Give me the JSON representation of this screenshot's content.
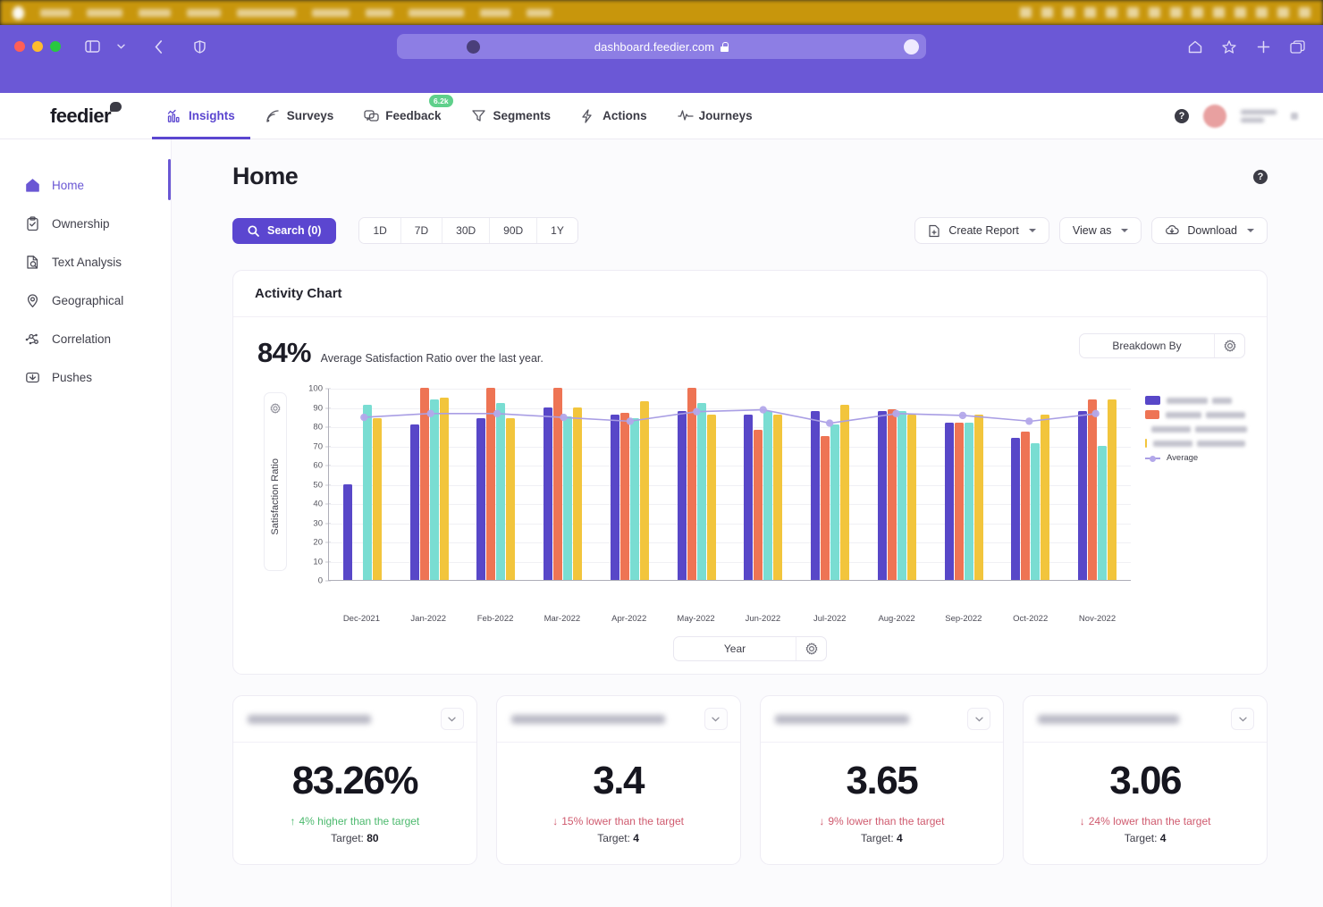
{
  "os": {
    "menu_widths": [
      34,
      40,
      36,
      38,
      66,
      42,
      30,
      62,
      34,
      28
    ],
    "right_icon_count": 14
  },
  "browser": {
    "url": "dashboard.feedier.com",
    "icons": {
      "sidebar": "sidebar-toggle-icon",
      "back": "back-chevron-icon",
      "shield": "privacy-shield-icon",
      "home": "home-icon",
      "bookmark": "bookmark-star-icon",
      "newtab": "new-tab-plus-icon",
      "tabs": "tab-overview-icon"
    }
  },
  "app_header": {
    "logo": "feedier",
    "nav": [
      {
        "label": "Insights",
        "icon": "insights-chart-icon",
        "active": true,
        "badge": null
      },
      {
        "label": "Surveys",
        "icon": "surveys-signal-icon",
        "active": false,
        "badge": null
      },
      {
        "label": "Feedback",
        "icon": "feedback-chat-icon",
        "active": false,
        "badge": "6.2k"
      },
      {
        "label": "Segments",
        "icon": "segments-filter-icon",
        "active": false,
        "badge": null
      },
      {
        "label": "Actions",
        "icon": "actions-bolt-icon",
        "active": false,
        "badge": null
      },
      {
        "label": "Journeys",
        "icon": "journeys-pulse-icon",
        "active": false,
        "badge": null
      }
    ],
    "help_glyph": "?"
  },
  "sidebar": {
    "items": [
      {
        "label": "Home",
        "icon": "home-icon",
        "active": true
      },
      {
        "label": "Ownership",
        "icon": "clipboard-check-icon",
        "active": false
      },
      {
        "label": "Text Analysis",
        "icon": "document-search-icon",
        "active": false
      },
      {
        "label": "Geographical",
        "icon": "map-pin-icon",
        "active": false
      },
      {
        "label": "Correlation",
        "icon": "nodes-graph-icon",
        "active": false
      },
      {
        "label": "Pushes",
        "icon": "envelope-arrow-icon",
        "active": false
      }
    ]
  },
  "page": {
    "title": "Home",
    "help_glyph": "?"
  },
  "toolbar": {
    "search_label": "Search (0)",
    "search_icon": "search-icon",
    "ranges": [
      "1D",
      "7D",
      "30D",
      "90D",
      "1Y"
    ],
    "actions": [
      {
        "label": "Create Report",
        "icon": "document-plus-icon",
        "caret": true
      },
      {
        "label": "View as",
        "icon": null,
        "caret": true
      },
      {
        "label": "Download",
        "icon": "cloud-download-icon",
        "caret": true
      }
    ]
  },
  "activity_card": {
    "title": "Activity Chart",
    "kpi_value": "84%",
    "kpi_caption": "Average Satisfaction Ratio over the last year.",
    "breakdown_label": "Breakdown By",
    "breakdown_gear_icon": "gear-icon",
    "axis_gear_icon": "gear-icon",
    "period_label": "Year",
    "period_gear_icon": "gear-icon"
  },
  "chart_data": {
    "type": "bar",
    "title": "Activity Chart",
    "xlabel": "",
    "ylabel": "Satisfaction Ratio",
    "ylim": [
      0,
      100
    ],
    "yticks": [
      0,
      10,
      20,
      30,
      40,
      50,
      60,
      70,
      80,
      90,
      100
    ],
    "grid": true,
    "legend_position": "right",
    "categories": [
      "Dec-2021",
      "Jan-2022",
      "Feb-2022",
      "Mar-2022",
      "Apr-2022",
      "May-2022",
      "Jun-2022",
      "Jul-2022",
      "Aug-2022",
      "Sep-2022",
      "Oct-2022",
      "Nov-2022"
    ],
    "series": [
      {
        "name": "",
        "label_redacted": true,
        "color": "#5847c8",
        "values": [
          50,
          81,
          84,
          90,
          86,
          88,
          86,
          88,
          88,
          82,
          74,
          88
        ]
      },
      {
        "name": "",
        "label_redacted": true,
        "color": "#ee7454",
        "values": [
          null,
          100,
          100,
          100,
          87,
          100,
          78,
          75,
          89,
          82,
          77,
          94
        ]
      },
      {
        "name": "",
        "label_redacted": true,
        "color": "#79ddd2",
        "values": [
          91,
          94,
          92,
          85,
          84,
          92,
          88,
          81,
          88,
          82,
          71,
          70
        ]
      },
      {
        "name": "",
        "label_redacted": true,
        "color": "#f2c53c",
        "values": [
          84,
          95,
          84,
          90,
          93,
          86,
          86,
          91,
          86,
          86,
          86,
          94
        ]
      }
    ],
    "overlay": {
      "name": "Average",
      "type": "line",
      "color": "#a99ee4",
      "marker_color": "#b3a8ea",
      "values": [
        85,
        87,
        87,
        85,
        83,
        88,
        89,
        82,
        87,
        86,
        83,
        87
      ]
    }
  },
  "kpi_cards": [
    {
      "title_redacted": true,
      "title_blur_width": 138,
      "value": "83.26%",
      "delta_direction": "up",
      "delta_arrow": "↑",
      "delta_text": "4% higher than the target",
      "target_label": "Target:",
      "target_value": "80",
      "caret_icon": "chevron-down-icon"
    },
    {
      "title_redacted": true,
      "title_blur_width": 172,
      "value": "3.4",
      "delta_direction": "down",
      "delta_arrow": "↓",
      "delta_text": "15% lower than the target",
      "target_label": "Target:",
      "target_value": "4",
      "caret_icon": "chevron-down-icon"
    },
    {
      "title_redacted": true,
      "title_blur_width": 150,
      "value": "3.65",
      "delta_direction": "down",
      "delta_arrow": "↓",
      "delta_text": "9% lower than the target",
      "target_label": "Target:",
      "target_value": "4",
      "caret_icon": "chevron-down-icon"
    },
    {
      "title_redacted": true,
      "title_blur_width": 158,
      "value": "3.06",
      "delta_direction": "down",
      "delta_arrow": "↓",
      "delta_text": "24% lower than the target",
      "target_label": "Target:",
      "target_value": "4",
      "caret_icon": "chevron-down-icon"
    }
  ],
  "colors": {
    "brand_purple": "#5b46d0",
    "chrome_purple": "#6b58d6",
    "positive_green": "#4bb96d",
    "negative_red": "#cf5a6e",
    "badge_green": "#5fd08b"
  }
}
